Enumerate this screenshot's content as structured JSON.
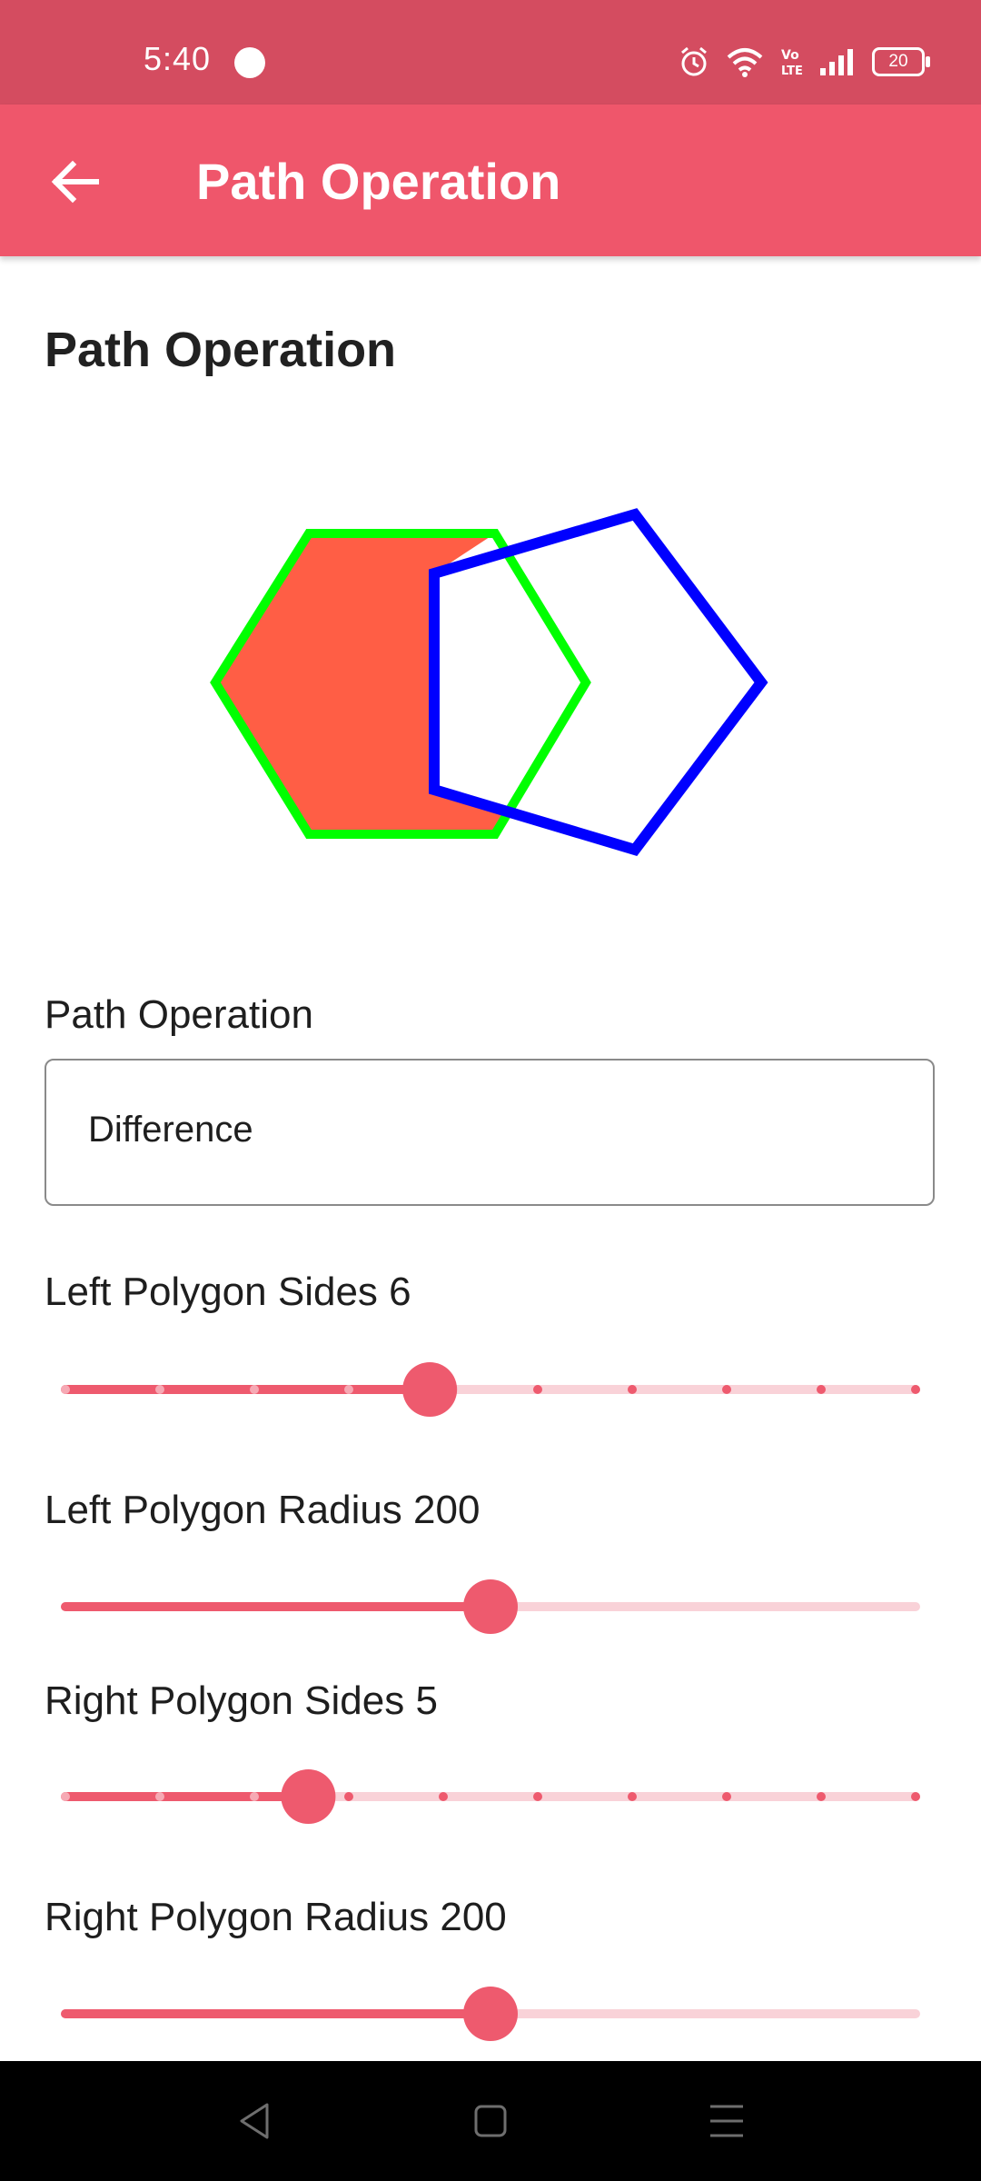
{
  "status": {
    "time": "5:40",
    "battery": "20"
  },
  "appbar": {
    "title": "Path Operation"
  },
  "main": {
    "heading": "Path Operation",
    "operation_label": "Path Operation",
    "operation_value": "Difference",
    "left_sides_label": "Left Polygon Sides 6",
    "left_radius_label": "Left Polygon Radius 200",
    "right_sides_label": "Right Polygon Sides 5",
    "right_radius_label": "Right Polygon Radius 200"
  },
  "sliders": {
    "left_sides": {
      "fraction": 0.4286,
      "stops": 10
    },
    "left_radius": {
      "fraction": 0.5,
      "stops": 0
    },
    "right_sides": {
      "fraction": 0.2857,
      "stops": 10
    },
    "right_radius": {
      "fraction": 0.5,
      "stops": 0
    }
  },
  "colors": {
    "status_bar": "#d44c60",
    "app_bar": "#ef566b",
    "accent": "#ee5a6e",
    "track_inactive": "#f9d2d8",
    "left_polygon_fill": "#ff5e45",
    "left_polygon_stroke": "#00ff00",
    "right_polygon_stroke": "#0000ff"
  }
}
